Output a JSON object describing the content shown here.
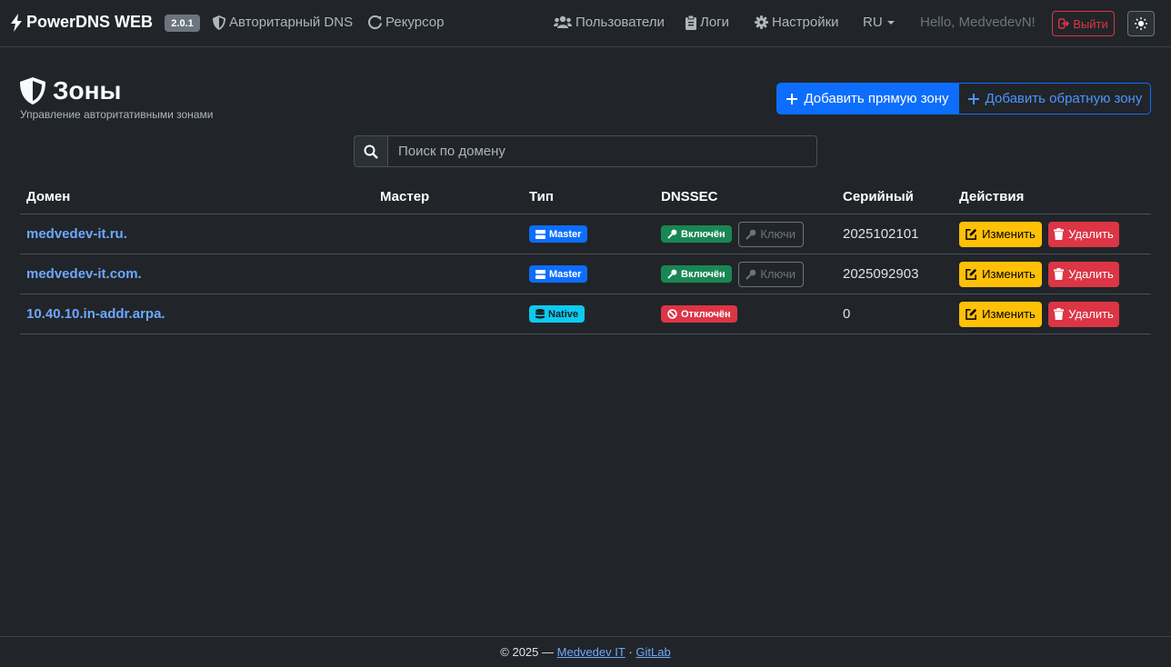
{
  "navbar": {
    "brand": "PowerDNS WEB",
    "version": "2.0.1",
    "links": {
      "auth_dns": "Авторитарный DNS",
      "recursor": "Рекурсор",
      "users": "Пользователи",
      "logs": "Логи",
      "settings": "Настройки",
      "lang": "RU"
    },
    "greeting": "Hello, MedvedevN!",
    "logout": "Выйти"
  },
  "header": {
    "title": "Зоны",
    "subtitle": "Управление авторитативными зонами",
    "add_forward": "Добавить прямую зону",
    "add_reverse": "Добавить обратную зону"
  },
  "search": {
    "placeholder": "Поиск по домену",
    "value": ""
  },
  "table": {
    "columns": {
      "domain": "Домен",
      "master": "Мастер",
      "type": "Тип",
      "dnssec": "DNSSEC",
      "serial": "Серийный",
      "actions": "Действия"
    },
    "rows": [
      {
        "domain": "medvedev-it.ru.",
        "master": "",
        "type": "Master",
        "dnssec": "Включён",
        "keys": "Ключи",
        "serial": "2025102101",
        "edit": "Изменить",
        "delete": "Удалить"
      },
      {
        "domain": "medvedev-it.com.",
        "master": "",
        "type": "Master",
        "dnssec": "Включён",
        "keys": "Ключи",
        "serial": "2025092903",
        "edit": "Изменить",
        "delete": "Удалить"
      },
      {
        "domain": "10.40.10.in-addr.arpa.",
        "master": "",
        "type": "Native",
        "dnssec": "Отключён",
        "serial": "0",
        "edit": "Изменить",
        "delete": "Удалить"
      }
    ]
  },
  "footer": {
    "copyright": "© 2025 —",
    "link1": "Medvedev IT",
    "sep": "·",
    "link2": "GitLab"
  },
  "colors": {
    "background": "#212529",
    "primary": "#0d6efd",
    "success": "#198754",
    "danger": "#dc3545",
    "warning": "#ffc107",
    "info": "#0dcaf0",
    "link": "#6ea8fe"
  }
}
